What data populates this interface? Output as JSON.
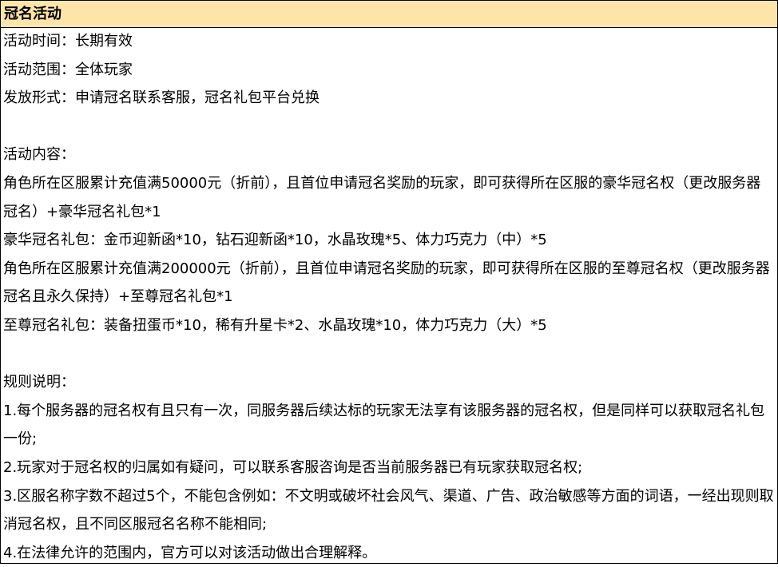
{
  "title": "冠名活动",
  "lines": [
    "活动时间：长期有效",
    "活动范围：全体玩家",
    "发放形式：申请冠名联系客服，冠名礼包平台兑换",
    "",
    "活动内容：",
    "角色所在区服累计充值满50000元（折前），且首位申请冠名奖励的玩家，即可获得所在区服的豪华冠名权（更改服务器冠名）+豪华冠名礼包*1",
    "豪华冠名礼包：金币迎新函*10，钻石迎新函*10，水晶玫瑰*5、体力巧克力（中）*5",
    "角色所在区服累计充值满200000元（折前），且首位申请冠名奖励的玩家，即可获得所在区服的至尊冠名权（更改服务器冠名且永久保持）+至尊冠名礼包*1",
    "至尊冠名礼包：装备扭蛋币*10，稀有升星卡*2、水晶玫瑰*10，体力巧克力（大）*5",
    "",
    "规则说明：",
    "1.每个服务器的冠名权有且只有一次，同服务器后续达标的玩家无法享有该服务器的冠名权，但是同样可以获取冠名礼包一份;",
    "2.玩家对于冠名权的归属如有疑问，可以联系客服咨询是否当前服务器已有玩家获取冠名权;",
    "3.区服名称字数不超过5个，不能包含例如：不文明或破坏社会风气、渠道、广告、政治敏感等方面的词语，一经出现则取消冠名权，且不同区服冠名名称不能相同;",
    "4.在法律允许的范围内，官方可以对该活动做出合理解释。"
  ]
}
